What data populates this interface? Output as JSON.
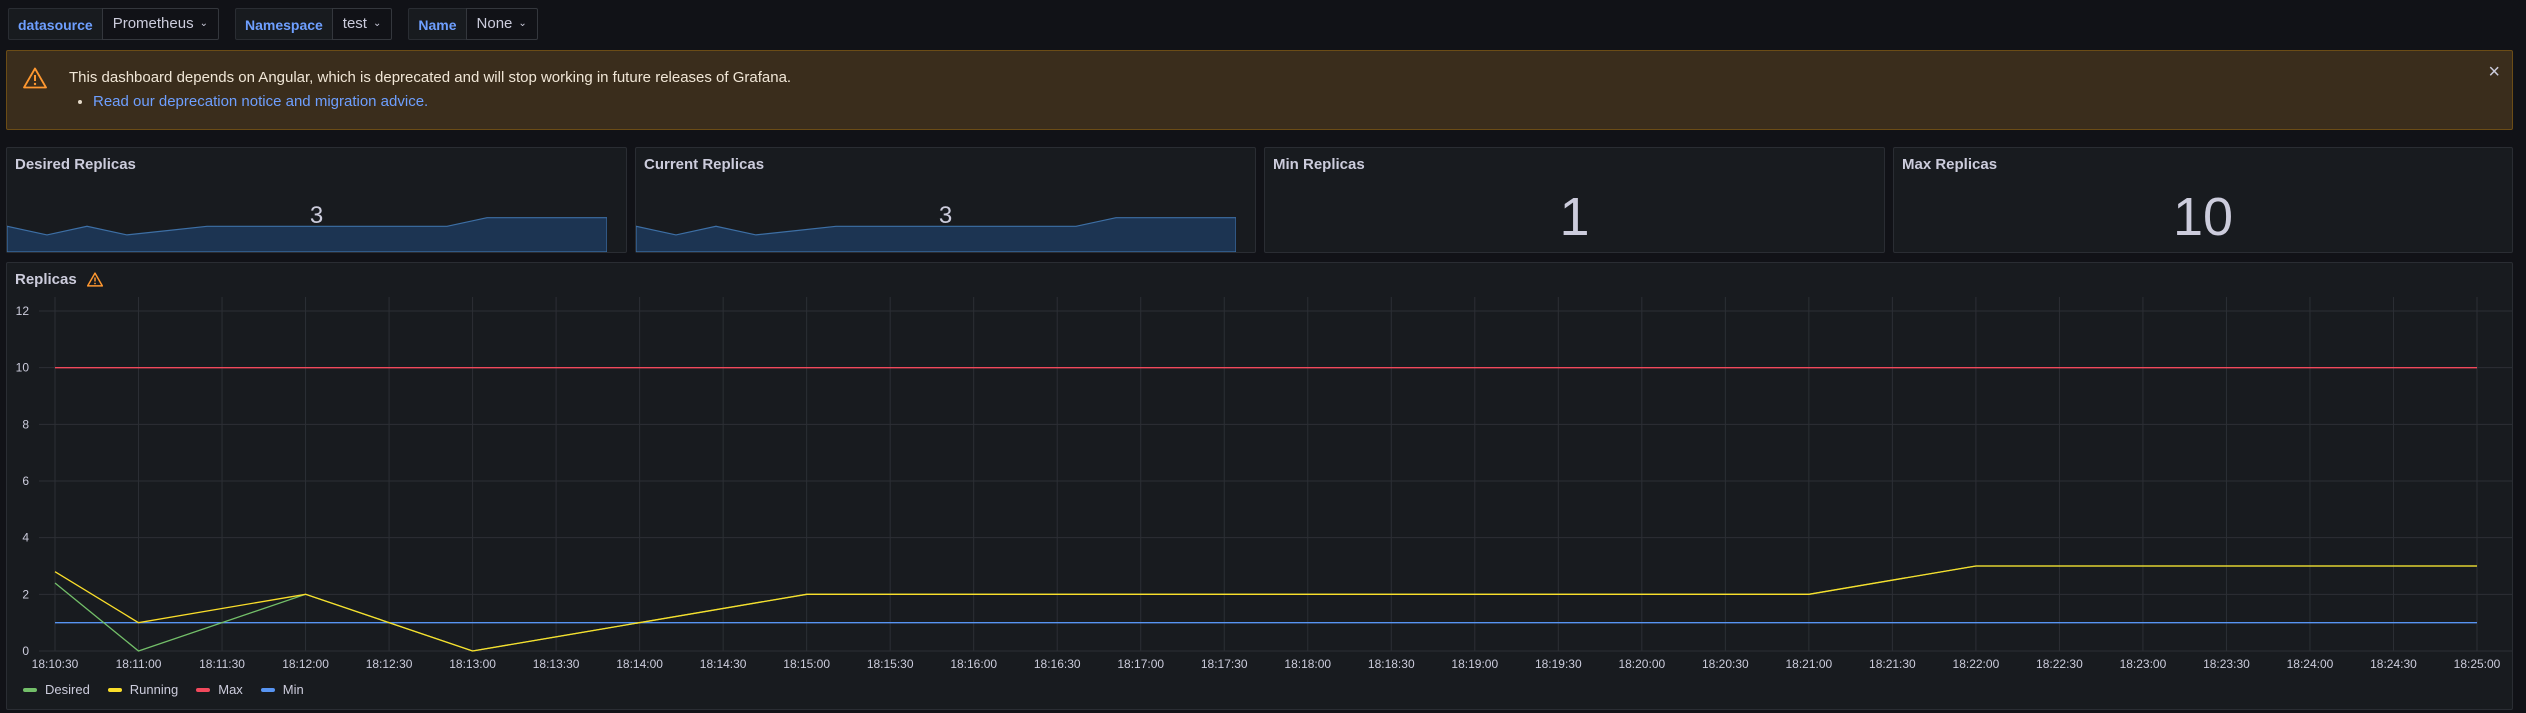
{
  "variables": [
    {
      "label": "datasource",
      "value": "Prometheus"
    },
    {
      "label": "Namespace",
      "value": "test"
    },
    {
      "label": "Name",
      "value": "None"
    }
  ],
  "alert": {
    "message": "This dashboard depends on Angular, which is deprecated and will stop working in future releases of Grafana.",
    "link": "Read our deprecation notice and migration advice.",
    "close": "×",
    "icon": "warning-icon"
  },
  "stats": [
    {
      "title": "Desired Replicas",
      "value": "3",
      "sparkline": [
        3,
        2,
        3,
        2,
        2.5,
        3,
        3,
        3,
        3,
        3,
        3,
        3,
        4,
        4,
        4,
        4
      ]
    },
    {
      "title": "Current Replicas",
      "value": "3",
      "sparkline": [
        3,
        2,
        3,
        2,
        2.5,
        3,
        3,
        3,
        3,
        3,
        3,
        3,
        4,
        4,
        4,
        4
      ]
    },
    {
      "title": "Min Replicas",
      "value": "1"
    },
    {
      "title": "Max Replicas",
      "value": "10"
    }
  ],
  "graph": {
    "title": "Replicas",
    "warning_icon": "warning-icon"
  },
  "colors": {
    "desired": "#73bf69",
    "running": "#fade2a",
    "max": "#f2495c",
    "min": "#5794f2",
    "warning": "#ff9830"
  },
  "chart_data": {
    "type": "line",
    "ylim": [
      0,
      12
    ],
    "yticks": [
      0,
      2,
      4,
      6,
      8,
      10,
      12
    ],
    "x_ticks": [
      "18:10:30",
      "18:11:00",
      "18:11:30",
      "18:12:00",
      "18:12:30",
      "18:13:00",
      "18:13:30",
      "18:14:00",
      "18:14:30",
      "18:15:00",
      "18:15:30",
      "18:16:00",
      "18:16:30",
      "18:17:00",
      "18:17:30",
      "18:18:00",
      "18:18:30",
      "18:19:00",
      "18:19:30",
      "18:20:00",
      "18:20:30",
      "18:21:00",
      "18:21:30",
      "18:22:00",
      "18:22:30",
      "18:23:00",
      "18:23:30",
      "18:24:00",
      "18:24:30",
      "18:25:00"
    ],
    "series": [
      {
        "name": "Desired",
        "color_key": "desired",
        "points": [
          [
            "18:10:30",
            2.4
          ],
          [
            "18:11:00",
            0
          ],
          [
            "18:12:00",
            2
          ],
          [
            "18:13:00",
            0
          ],
          [
            "18:15:00",
            2
          ],
          [
            "18:21:00",
            2
          ],
          [
            "18:22:00",
            3
          ],
          [
            "18:25:00",
            3
          ]
        ]
      },
      {
        "name": "Running",
        "color_key": "running",
        "points": [
          [
            "18:10:30",
            2.8
          ],
          [
            "18:11:00",
            1
          ],
          [
            "18:12:00",
            2
          ],
          [
            "18:13:00",
            0
          ],
          [
            "18:15:00",
            2
          ],
          [
            "18:21:00",
            2
          ],
          [
            "18:22:00",
            3
          ],
          [
            "18:25:00",
            3
          ]
        ]
      },
      {
        "name": "Max",
        "color_key": "max",
        "points": [
          [
            "18:10:30",
            10
          ],
          [
            "18:25:00",
            10
          ]
        ]
      },
      {
        "name": "Min",
        "color_key": "min",
        "points": [
          [
            "18:10:30",
            1
          ],
          [
            "18:25:00",
            1
          ]
        ]
      }
    ]
  }
}
